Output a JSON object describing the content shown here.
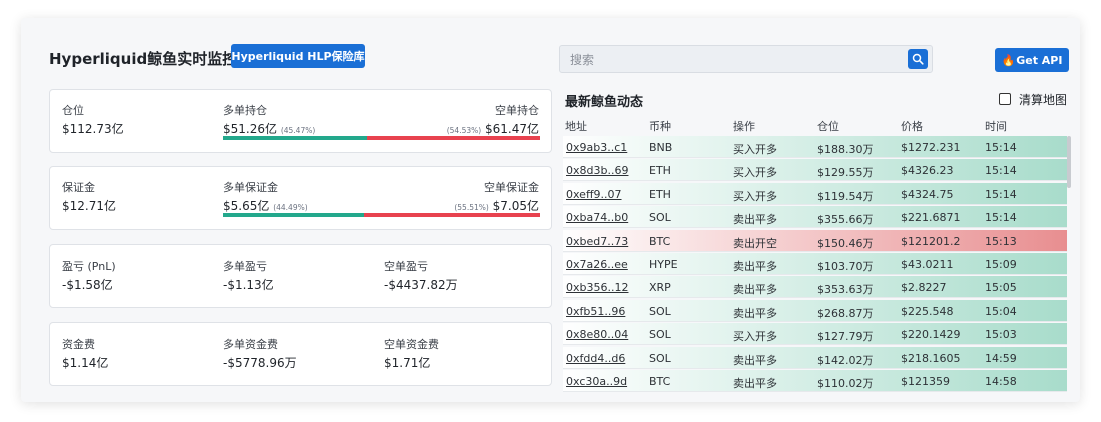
{
  "header": {
    "title": "Hyperliquid鲸鱼实时监控",
    "hlp_button": "Hyperliquid HLP保险库",
    "api_button": "Get API",
    "api_icon": "fire-icon"
  },
  "search": {
    "placeholder": "搜索",
    "icon": "search-icon"
  },
  "stats": {
    "position": {
      "total_label": "仓位",
      "total_value": "$112.73亿",
      "long_label": "多单持仓",
      "long_value": "$51.26亿",
      "long_pct": "(45.47%)",
      "short_label": "空单持仓",
      "short_value": "$61.47亿",
      "short_pct": "(54.53%)",
      "long_fraction": 0.4547
    },
    "margin": {
      "total_label": "保证金",
      "total_value": "$12.71亿",
      "long_label": "多单保证金",
      "long_value": "$5.65亿",
      "long_pct": "(44.49%)",
      "short_label": "空单保证金",
      "short_value": "$7.05亿",
      "short_pct": "(55.51%)",
      "long_fraction": 0.4449
    },
    "pnl": {
      "total_label": "盈亏 (PnL)",
      "total_value": "-$1.58亿",
      "long_label": "多单盈亏",
      "long_value": "-$1.13亿",
      "short_label": "空单盈亏",
      "short_value": "-$4437.82万"
    },
    "funding": {
      "total_label": "资金费",
      "total_value": "$1.14亿",
      "long_label": "多单资金费",
      "long_value": "-$5778.96万",
      "short_label": "空单资金费",
      "short_value": "$1.71亿"
    }
  },
  "feed": {
    "title": "最新鲸鱼动态",
    "map_toggle_label": "清算地图",
    "map_toggle_checked": false,
    "columns": [
      "地址",
      "币种",
      "操作",
      "仓位",
      "价格",
      "时间"
    ],
    "rows": [
      {
        "address": "0x9ab3..c1",
        "coin": "BNB",
        "action": "买入开多",
        "position": "$188.30万",
        "price": "$1272.231",
        "time": "15:14"
      },
      {
        "address": "0x8d3b..69",
        "coin": "ETH",
        "action": "买入开多",
        "position": "$129.55万",
        "price": "$4326.23",
        "time": "15:14"
      },
      {
        "address": "0xeff9..07",
        "coin": "ETH",
        "action": "买入开多",
        "position": "$119.54万",
        "price": "$4324.75",
        "time": "15:14"
      },
      {
        "address": "0xba74..b0",
        "coin": "SOL",
        "action": "卖出平多",
        "position": "$355.66万",
        "price": "$221.6871",
        "time": "15:14"
      },
      {
        "address": "0xbed7..73",
        "coin": "BTC",
        "action": "卖出开空",
        "position": "$150.46万",
        "price": "$121201.2",
        "time": "15:13"
      },
      {
        "address": "0x7a26..ee",
        "coin": "HYPE",
        "action": "卖出平多",
        "position": "$103.70万",
        "price": "$43.0211",
        "time": "15:09"
      },
      {
        "address": "0xb356..12",
        "coin": "XRP",
        "action": "卖出平多",
        "position": "$353.63万",
        "price": "$2.8227",
        "time": "15:05"
      },
      {
        "address": "0xfb51..96",
        "coin": "SOL",
        "action": "卖出平多",
        "position": "$268.87万",
        "price": "$225.548",
        "time": "15:04"
      },
      {
        "address": "0x8e80..04",
        "coin": "SOL",
        "action": "买入开多",
        "position": "$127.79万",
        "price": "$220.1429",
        "time": "15:03"
      },
      {
        "address": "0xfdd4..d6",
        "coin": "SOL",
        "action": "卖出平多",
        "position": "$142.02万",
        "price": "$218.1605",
        "time": "14:59"
      },
      {
        "address": "0xc30a..9d",
        "coin": "BTC",
        "action": "卖出平多",
        "position": "$110.02万",
        "price": "$121359",
        "time": "14:58"
      }
    ]
  },
  "colors": {
    "accent": "#1a6fd6",
    "long": "#23a88c",
    "short": "#e8424f",
    "row_green": "#a8dccb",
    "row_red": "#e88e90"
  }
}
